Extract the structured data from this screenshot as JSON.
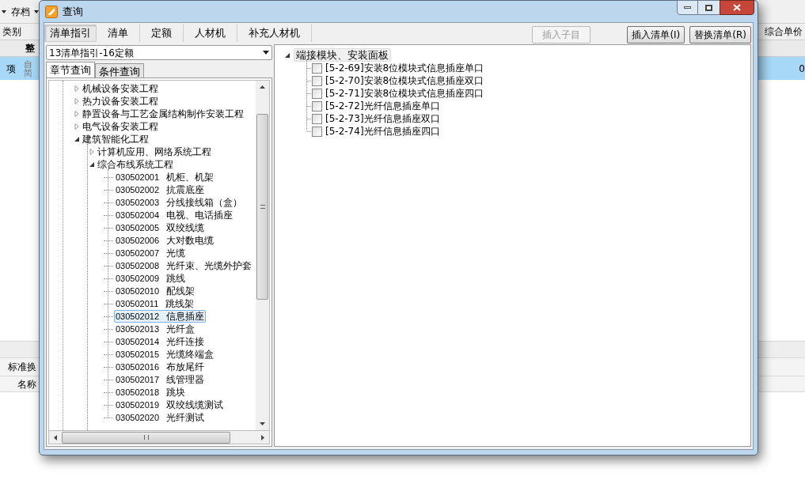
{
  "app": {
    "toolbar": {
      "archive_menu": "存档"
    },
    "grid": {
      "columns": [
        "类别",
        "综合单价"
      ],
      "group_row": "整",
      "selected_row": {
        "type": "项",
        "desc_lines": [
          "自",
          "简"
        ],
        "value": "0"
      }
    },
    "bottom": {
      "tab": "标准换",
      "column": "名称"
    }
  },
  "dialog": {
    "title": "查询",
    "tabs": [
      {
        "label": "清单指引",
        "selected": true
      },
      {
        "label": "清单",
        "selected": false
      },
      {
        "label": "定额",
        "selected": false
      },
      {
        "label": "人材机",
        "selected": false
      },
      {
        "label": "补充人材机",
        "selected": false
      }
    ],
    "buttons": [
      {
        "label": "插入子目",
        "disabled": true
      },
      {
        "label": "插入清单",
        "key": "(I)",
        "disabled": false
      },
      {
        "label": "替换清单",
        "key": "(R)",
        "disabled": false
      }
    ],
    "library": "13清单指引-16定额",
    "subtabs": [
      {
        "label": "章节查询",
        "selected": true
      },
      {
        "label": "条件查询",
        "selected": false
      }
    ],
    "tree": [
      {
        "label": "机械设备安装工程",
        "expanded": false
      },
      {
        "label": "热力设备安装工程",
        "expanded": false
      },
      {
        "label": "静置设备与工艺金属结构制作安装工程",
        "expanded": false
      },
      {
        "label": "电气设备安装工程",
        "expanded": false
      },
      {
        "label": "建筑智能化工程",
        "expanded": true,
        "children": [
          {
            "label": "计算机应用、网络系统工程",
            "expanded": false
          },
          {
            "label": "综合布线系统工程",
            "expanded": true,
            "children": [
              {
                "code": "030502001",
                "name": "机柜、机架",
                "selected": false
              },
              {
                "code": "030502002",
                "name": "抗震底座",
                "selected": false
              },
              {
                "code": "030502003",
                "name": "分线接线箱（盒）",
                "selected": false
              },
              {
                "code": "030502004",
                "name": "电视、电话插座",
                "selected": false
              },
              {
                "code": "030502005",
                "name": "双绞线缆",
                "selected": false
              },
              {
                "code": "030502006",
                "name": "大对数电缆",
                "selected": false
              },
              {
                "code": "030502007",
                "name": "光缆",
                "selected": false
              },
              {
                "code": "030502008",
                "name": "光纤束、光缆外护套",
                "selected": false
              },
              {
                "code": "030502009",
                "name": "跳线",
                "selected": false
              },
              {
                "code": "030502010",
                "name": "配线架",
                "selected": false
              },
              {
                "code": "030502011",
                "name": "跳线架",
                "selected": false
              },
              {
                "code": "030502012",
                "name": "信息插座",
                "selected": true
              },
              {
                "code": "030502013",
                "name": "光纤盒",
                "selected": false
              },
              {
                "code": "030502014",
                "name": "光纤连接",
                "selected": false
              },
              {
                "code": "030502015",
                "name": "光缆终端盒",
                "selected": false
              },
              {
                "code": "030502016",
                "name": "布放尾纤",
                "selected": false
              },
              {
                "code": "030502017",
                "name": "线管理器",
                "selected": false
              },
              {
                "code": "030502018",
                "name": "跳块",
                "selected": false
              },
              {
                "code": "030502019",
                "name": "双绞线缆测试",
                "selected": false
              },
              {
                "code": "030502020",
                "name": "光纤测试",
                "selected": false
              }
            ]
          }
        ]
      }
    ],
    "quota_tree": {
      "label": "端接模块、安装面板",
      "expanded": true,
      "selected": true,
      "children": [
        {
          "label": "[5-2-69]安装8位模块式信息插座单口",
          "checked": false,
          "selected": false
        },
        {
          "label": "[5-2-70]安装8位模块式信息插座双口",
          "checked": false,
          "selected": false
        },
        {
          "label": "[5-2-71]安装8位模块式信息插座四口",
          "checked": false,
          "selected": false
        },
        {
          "label": "[5-2-72]光纤信息插座单口",
          "checked": false,
          "selected": false
        },
        {
          "label": "[5-2-73]光纤信息插座双口",
          "checked": false,
          "selected": false
        },
        {
          "label": "[5-2-74]光纤信息插座四口",
          "checked": false,
          "selected": false
        }
      ]
    }
  }
}
